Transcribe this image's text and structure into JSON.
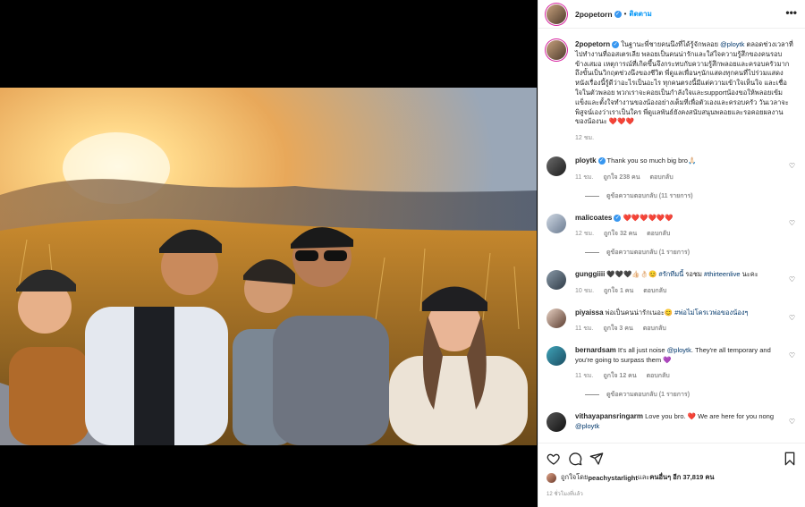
{
  "post": {
    "username": "2popetorn",
    "follow_label": "ติดตาม",
    "more_label": "•••"
  },
  "caption": {
    "username": "2popetorn",
    "text_before": "ในฐานะพี่ชายคนนึงที่ได้รู้จักพลอย ",
    "mention": "@ploytk",
    "text_after": " ตลอดช่วงเวลาที่ไปทำงานที่ออสเตรเลีย พลอยเป็นคนน่ารักและใส่ใจความรู้สึกของคนรอบข้างเสมอ เหตุการณ์ที่เกิดขึ้นจึงกระทบกับความรู้สึกพลอยและครอบครัวมากถึงขั้นเป็นวิกฤตช่วงนึงของชีวิต พี่ดูแลเพื่อนๆนักแสดงทุกคนที่ไปร่วมแสดงหนังเรื่องนี้รู้ดีว่าอะไรเป็นอะไร ทุกคนตรงนี้มีแต่ความเข้าใจเห็นใจ และเชื่อใจในตัวพลอย พวกเราจะคอยเป็นกำลังใจและsupportน้องขอให้พลอยเข้มแข็งและตั้งใจทำงานของน้องอย่างเต็มที่เพื่อตัวเองและครอบครัว วันเวลาจะพิสูจน์เองว่าเราเป็นใคร พี่ดูแลพันธ์ยังคงสนับสนุนพลอยและรอคอยผลงานของน้องนะ ",
    "hearts": "❤️❤️❤️",
    "time": "12 ชม."
  },
  "comments": [
    {
      "username": "ploytk",
      "verified": true,
      "text": "Thank you so much big bro🙏🏻",
      "time": "11 ชม.",
      "likes": "ถูกใจ 238 คน",
      "reply": "ตอบกลับ",
      "view_replies": "ดูข้อความตอบกลับ (11 รายการ)"
    },
    {
      "username": "malicoates",
      "verified": true,
      "text": "❤️❤️❤️❤️❤️❤️",
      "time": "12 ชม.",
      "likes": "ถูกใจ 32 คน",
      "reply": "ตอบกลับ",
      "view_replies": "ดูข้อความตอบกลับ (1 รายการ)"
    },
    {
      "username": "gunggiiii",
      "text_before": "🖤🖤🖤👍🏻👌🏻😊 ",
      "hashtag1": "#รักทีมนี้",
      "mid": " รอชม ",
      "hashtag2": "#thirteenlive",
      "text_after": " นะคะ",
      "time": "10 ชม.",
      "likes": "ถูกใจ 1 คน",
      "reply": "ตอบกลับ"
    },
    {
      "username": "piyaissa",
      "text_before": "พ่อเป็นคนน่ารักเนอะ😊 ",
      "hashtag1": "#พ่อไม่โครเวพ่อของน้องๆ",
      "time": "11 ชม.",
      "likes": "ถูกใจ 3 คน",
      "reply": "ตอบกลับ"
    },
    {
      "username": "bernardsam",
      "text_before": "It's all just noise ",
      "mention": "@ploytk",
      "text_after": ". They're all temporary and you're going to surpass them ",
      "emoji": "💜",
      "time": "11 ชม.",
      "likes": "ถูกใจ 12 คน",
      "reply": "ตอบกลับ",
      "view_replies": "ดูข้อความตอบกลับ (1 รายการ)"
    },
    {
      "username": "vithayapansringarm",
      "text_before": "Love you bro. ",
      "emoji": "❤️",
      "text_after": " We are here for you nong ",
      "mention": "@ploytk"
    }
  ],
  "footer": {
    "liked_by_prefix": "ถูกใจโดย ",
    "liked_by_user": "peachystarlight",
    "liked_by_mid": " และ ",
    "liked_by_others": "คนอื่นๆ อีก 37,819 คน",
    "posted": "12 ชั่วโมงที่แล้ว"
  },
  "colors": {
    "link": "#00376b",
    "follow": "#0095f6",
    "verified": "#3897f0",
    "meta_gray": "#8e8e8e"
  }
}
